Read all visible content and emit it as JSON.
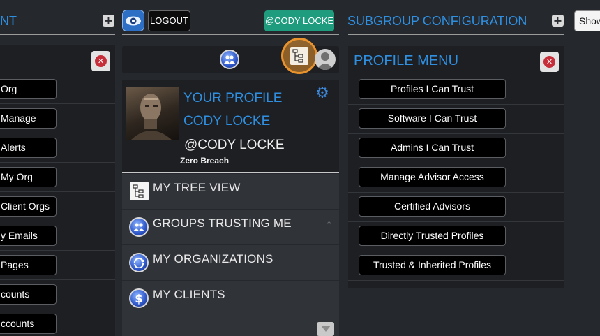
{
  "left": {
    "title": "NT",
    "items": [
      "Org",
      "Manage",
      "Alerts",
      "My Org",
      "Client Orgs",
      "y Emails",
      "Pages",
      "counts",
      "ccounts"
    ]
  },
  "top": {
    "logout_label": "LOGOUT",
    "user_handle_label": "@CODY LOCKE",
    "subgroup_title": "SUBGROUP CONFIGURATION",
    "show_label": "Show"
  },
  "profile": {
    "title": "YOUR PROFILE",
    "name": "CODY LOCKE",
    "handle": "@CODY LOCKE",
    "org": "Zero Breach"
  },
  "menu": {
    "items": [
      {
        "label": "MY TREE VIEW",
        "icon": "tree-view-icon"
      },
      {
        "label": "GROUPS TRUSTING ME",
        "icon": "groups-icon"
      },
      {
        "label": "MY ORGANIZATIONS",
        "icon": "organizations-icon"
      },
      {
        "label": "MY CLIENTS",
        "icon": "dollar-icon"
      }
    ]
  },
  "profile_menu": {
    "title": "PROFILE MENU",
    "items": [
      "Profiles I Can Trust",
      "Software I Can Trust",
      "Admins I Can Trust",
      "Manage Advisor Access",
      "Certified Advisors",
      "Directly Trusted Profiles",
      "Trusted & Inherited Profiles"
    ]
  },
  "colors": {
    "background": "#25282d",
    "panel": "#1d1f23",
    "accent_blue": "#2f8fe0",
    "green": "#1f9b7e",
    "highlight_orange": "#e8932d"
  }
}
